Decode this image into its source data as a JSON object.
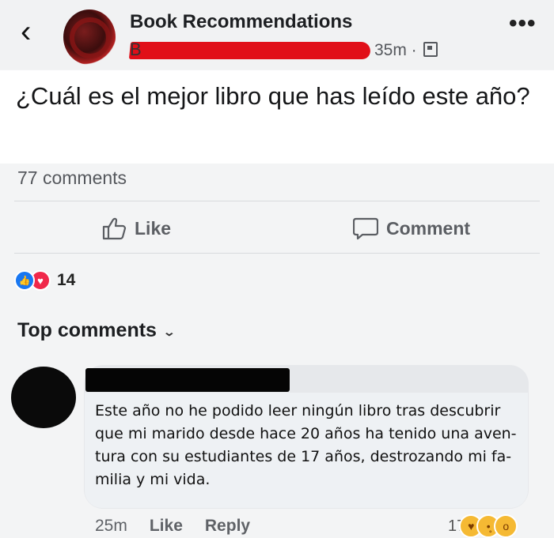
{
  "header": {
    "group_name": "Book Recommendations",
    "author_initial": "B",
    "time": "35m ·",
    "back_icon": "chevron-left-icon",
    "more_icon": "more-horizontal-icon"
  },
  "post": {
    "question": "¿Cuál es el mejor libro que has leído este año?",
    "comment_count": "77 comments",
    "actions": {
      "like": "Like",
      "comment": "Comment"
    },
    "reactions": {
      "icons": [
        "like-reaction-icon",
        "love-reaction-icon"
      ],
      "count": "14"
    },
    "top_comments_label": "Top comments"
  },
  "comment": {
    "lines": [
      "Este año no he podido leer ningún libro tras descubrir",
      "que mi marido desde hace 20 años ha tenido una aven-",
      "tura con su estudiantes de 17 años, destrozando mi fa-",
      "milia y mi vida."
    ],
    "time": "25m",
    "like": "Like",
    "reply": "Reply",
    "reaction_count": "17",
    "reaction_icons": [
      "care-reaction-icon",
      "sad-reaction-icon",
      "wow-reaction-icon"
    ]
  },
  "colors": {
    "like_blue": "#1877f2",
    "love_red": "#f0284a",
    "redact_red": "#e10f18"
  }
}
